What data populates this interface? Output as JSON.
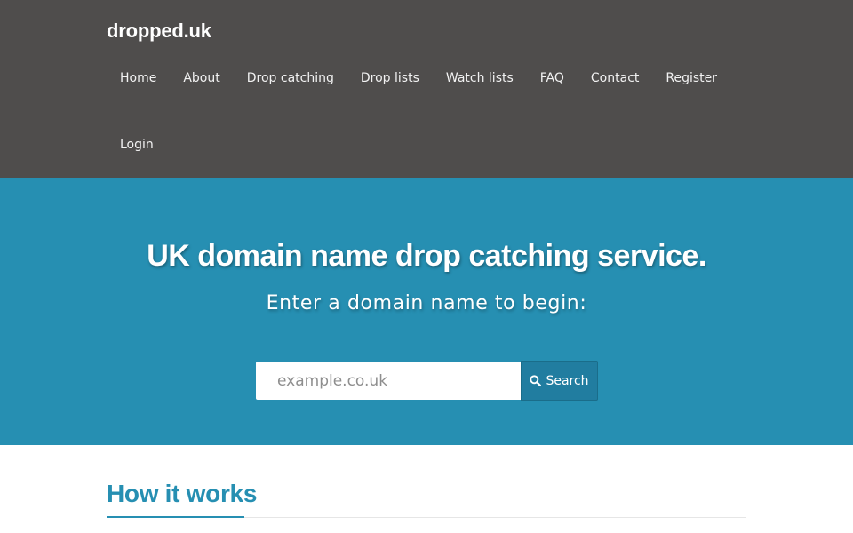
{
  "header": {
    "brand": "dropped.uk",
    "nav": [
      {
        "label": "Home"
      },
      {
        "label": "About"
      },
      {
        "label": "Drop catching"
      },
      {
        "label": "Drop lists"
      },
      {
        "label": "Watch lists"
      },
      {
        "label": "FAQ"
      },
      {
        "label": "Contact"
      },
      {
        "label": "Register"
      },
      {
        "label": "Login"
      }
    ]
  },
  "hero": {
    "title": "UK domain name drop catching service.",
    "subtitle": "Enter a domain name to begin:",
    "search": {
      "placeholder": "example.co.uk",
      "value": "",
      "button_label": "Search",
      "button_icon": "search-icon"
    }
  },
  "main": {
    "section_title": "How it works"
  },
  "colors": {
    "header_bg": "#4f4d4c",
    "hero_bg": "#268fb2",
    "accent": "#268fb2",
    "button_bg": "#217da0"
  }
}
